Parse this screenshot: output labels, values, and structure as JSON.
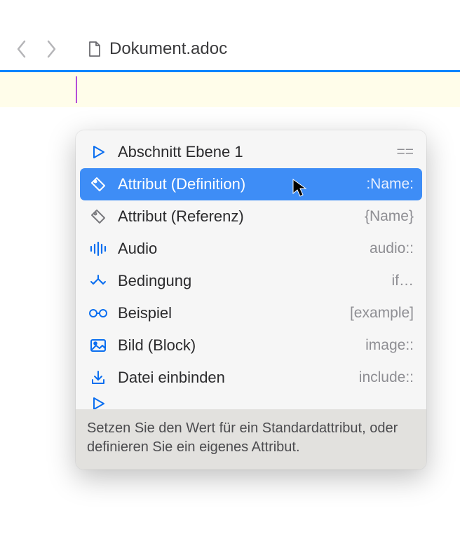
{
  "toolbar": {
    "filename": "Dokument.adoc"
  },
  "completion": {
    "items": [
      {
        "label": "Abschnitt Ebene 1",
        "hint": "==",
        "icon": "play",
        "selected": false
      },
      {
        "label": "Attribut (Definition)",
        "hint": ":Name:",
        "icon": "tag",
        "selected": true
      },
      {
        "label": "Attribut (Referenz)",
        "hint": "{Name}",
        "icon": "tag-outline",
        "selected": false
      },
      {
        "label": "Audio",
        "hint": "audio::",
        "icon": "audio",
        "selected": false
      },
      {
        "label": "Bedingung",
        "hint": "if…",
        "icon": "branch",
        "selected": false
      },
      {
        "label": "Beispiel",
        "hint": "[example]",
        "icon": "glasses",
        "selected": false
      },
      {
        "label": "Bild (Block)",
        "hint": "image::",
        "icon": "image",
        "selected": false
      },
      {
        "label": "Datei einbinden",
        "hint": "include::",
        "icon": "download",
        "selected": false
      }
    ],
    "description": "Setzen Sie den Wert für ein Standardattribut, oder definieren Sie ein eigenes Attribut."
  }
}
